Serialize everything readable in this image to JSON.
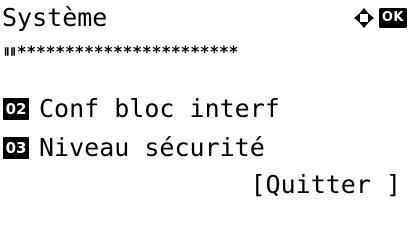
{
  "screen": {
    "title": "Système",
    "ok_label": "OK",
    "nav_icon": "up-down-left-right-arrows-icon",
    "password_mask": {
      "prefix": "ⅡⅡ",
      "asterisks": "***********************"
    },
    "menu_items": [
      {
        "number": "02",
        "label": "Conf bloc interf"
      },
      {
        "number": "03",
        "label": "Niveau sécurité"
      }
    ],
    "exit_button": "[Quitter ]"
  },
  "colors": {
    "foreground": "#000000",
    "background": "#ffffff",
    "badge_text": "#ffffff"
  }
}
